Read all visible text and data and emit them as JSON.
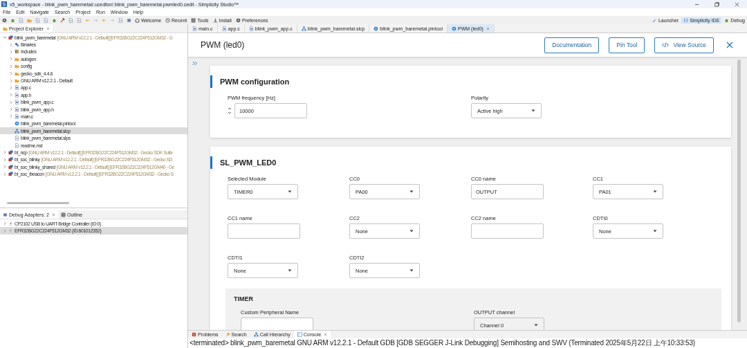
{
  "window": {
    "title": "v5_workspace - blink_pwm_baremetal/.uceditor/.blink_pwm_baremetal.pwmled0.cedit - Simplicity Studio™"
  },
  "menu": [
    "File",
    "Edit",
    "Navigate",
    "Search",
    "Project",
    "Run",
    "Window",
    "Help"
  ],
  "toolbar": {
    "links": [
      {
        "label": "Welcome"
      },
      {
        "label": "Recent"
      },
      {
        "label": "Tools"
      },
      {
        "label": "Install"
      },
      {
        "label": "Preferences"
      }
    ],
    "perspectives": [
      {
        "label": "Launcher",
        "selected": false
      },
      {
        "label": "Simplicity IDE",
        "selected": true
      },
      {
        "label": "Debug",
        "selected": false
      }
    ]
  },
  "project_explorer": {
    "title": "Project Explorer",
    "items": [
      {
        "label": "blink_pwm_baremetal",
        "note": "[GNU ARM v12.2.1 - Default] [EFR32BG22C224F512GM32 - G",
        "kind": "project",
        "expanded": true,
        "selected": false,
        "children": [
          {
            "label": "Binaries",
            "kind": "binaries",
            "expanded": false,
            "selected": false
          },
          {
            "label": "Includes",
            "kind": "includes",
            "expanded": false,
            "selected": false
          },
          {
            "label": "autogen",
            "kind": "folder",
            "expanded": false,
            "selected": false
          },
          {
            "label": "config",
            "kind": "folder",
            "expanded": false,
            "selected": false
          },
          {
            "label": "gecko_sdk_4.4.6",
            "kind": "folder",
            "expanded": false,
            "selected": false
          },
          {
            "label": "GNU ARM v12.2.1 - Default",
            "kind": "folder",
            "expanded": false,
            "selected": false
          },
          {
            "label": "app.c",
            "kind": "source",
            "expanded": false,
            "selected": false
          },
          {
            "label": "app.h",
            "kind": "header",
            "expanded": false,
            "selected": false
          },
          {
            "label": "blink_pwm_app.c",
            "kind": "source",
            "expanded": false,
            "selected": false
          },
          {
            "label": "blink_pwm_app.h",
            "kind": "header",
            "expanded": false,
            "selected": false
          },
          {
            "label": "main.c",
            "kind": "source",
            "expanded": false,
            "selected": false
          },
          {
            "label": "blink_pwm_baremetal.pintool",
            "kind": "pintool",
            "selected": false
          },
          {
            "label": "blink_pwm_baremetal.slcp",
            "kind": "slcp",
            "selected": true
          },
          {
            "label": "blink_pwm_baremetal.slps",
            "kind": "file",
            "selected": false
          },
          {
            "label": "readme.md",
            "kind": "file",
            "selected": false
          }
        ]
      },
      {
        "label": "bt_ncp",
        "note": "[GNU ARM v12.2.1 - Default] [EFR32BG22C224F512GM32 - Gecko SDK Suite",
        "kind": "project",
        "expanded": false,
        "selected": false
      },
      {
        "label": "bt_soc_blinky",
        "note": "[GNU ARM v12.2.1 - Default] [EFR32BG22C224F512GM32 - Gecko SD",
        "kind": "project",
        "expanded": false,
        "selected": false
      },
      {
        "label": "bt_soc_blinky_shared",
        "note": "[GNU ARM v12.2.1 - Default] [EFR32BG22C224F512GM40 - Ge",
        "kind": "project",
        "expanded": false,
        "selected": false
      },
      {
        "label": "bt_soc_ibeacon",
        "note": "[GNU ARM v12.2.1 - Default] [EFR32BG22C224F512GM32 - Gecko S",
        "kind": "project",
        "expanded": false,
        "selected": false
      }
    ]
  },
  "debug_adapters": {
    "tabs": [
      {
        "label": "Debug Adapters: 2",
        "selected": true
      },
      {
        "label": "Outline",
        "selected": false
      }
    ],
    "items": [
      {
        "label": "CP2102 USB to UART Bridge Controller (ID:0)",
        "selected": false
      },
      {
        "label": "EFR32BG22C224F512GM32 (ID:601012352)",
        "selected": true
      }
    ]
  },
  "editor_tabs": [
    {
      "label": "main.c",
      "kind": "source",
      "selected": false
    },
    {
      "label": "app.c",
      "kind": "source",
      "selected": false
    },
    {
      "label": "blink_pwm_app.c",
      "kind": "source",
      "selected": false
    },
    {
      "label": "blink_pwm_baremetal.slcp",
      "kind": "slcp",
      "selected": false
    },
    {
      "label": "blink_pwm_baremetal.pintool",
      "kind": "pintool",
      "selected": false
    },
    {
      "label": "PWM (led0)",
      "kind": "config",
      "selected": true
    }
  ],
  "editor": {
    "title": "PWM (led0)",
    "buttons": [
      {
        "label": "Documentation"
      },
      {
        "label": "Pin Tool"
      },
      {
        "label": "View Source"
      }
    ],
    "sections": [
      {
        "title": "PWM configuration",
        "fields": [
          {
            "label": "PWM frequency [Hz]",
            "kind": "number",
            "value": "10000"
          },
          {
            "label": "Polarity",
            "kind": "select",
            "value": "Active high"
          }
        ]
      },
      {
        "title": "SL_PWM_LED0",
        "fields": [
          {
            "label": "Selected Module",
            "kind": "select",
            "value": "TIMER0"
          },
          {
            "label": "CC0",
            "kind": "select",
            "value": "PA00"
          },
          {
            "label": "CC0 name",
            "kind": "input",
            "value": "OUTPUT"
          },
          {
            "label": "CC1",
            "kind": "select",
            "value": "PA01"
          },
          {
            "label": "CC1 name",
            "kind": "input"
          },
          {
            "label": "CC2",
            "kind": "select",
            "value": "None"
          },
          {
            "label": "CC2 name",
            "kind": "input"
          },
          {
            "label": "CDTI0",
            "kind": "select",
            "value": "None"
          },
          {
            "label": "CDTI1",
            "kind": "select",
            "value": "None"
          },
          {
            "label": "CDTI2",
            "kind": "select",
            "value": "None"
          }
        ],
        "subsection": {
          "title": "TIMER",
          "fields": [
            {
              "label": "Custom Peripheral Name",
              "kind": "input"
            },
            {
              "label": "OUTPUT channel",
              "kind": "select",
              "value": "Channel 0"
            }
          ]
        }
      }
    ]
  },
  "bottom_panel": {
    "tabs": [
      {
        "label": "Problems",
        "selected": false
      },
      {
        "label": "Search",
        "selected": false
      },
      {
        "label": "Call Hierarchy",
        "selected": false
      },
      {
        "label": "Console",
        "selected": true
      }
    ],
    "console_line": "<terminated> blink_pwm_baremetal GNU ARM v12.2.1 - Default GDB [GDB SEGGER J-Link Debugging] Semihosting and SWV (Terminated 2025年5月22日 上午10:33:53)"
  }
}
